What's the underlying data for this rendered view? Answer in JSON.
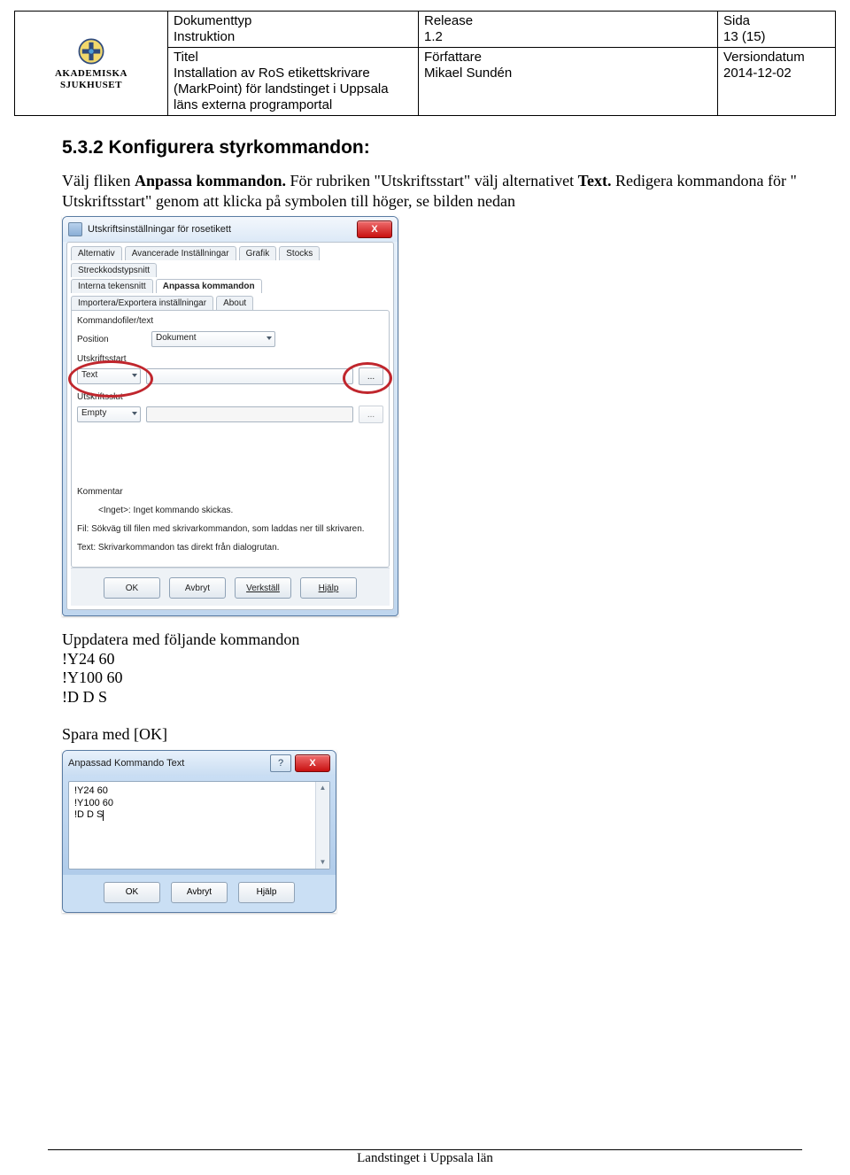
{
  "header": {
    "logo": {
      "line1": "AKADEMISKA",
      "line2": "SJUKHUSET"
    },
    "row1": {
      "doctype_label": "Dokumenttyp",
      "doctype_value": "Instruktion",
      "release_label": "Release",
      "release_value": "1.2",
      "page_label": "Sida",
      "page_value": "13 (15)"
    },
    "row2": {
      "title_label": "Titel",
      "title_value": "Installation av RoS etikettskrivare (MarkPoint) för landstinget i Uppsala läns externa programportal",
      "author_label": "Författare",
      "author_value": "Mikael Sundén",
      "versiondate_label": "Versiondatum",
      "versiondate_value": "2014-12-02"
    }
  },
  "section_heading": "5.3.2   Konfigurera styrkommandon:",
  "para": {
    "pre": "Välj fliken ",
    "bold1": "Anpassa kommandon.",
    "mid1": " För rubriken \"Utskriftsstart\" välj alternativet ",
    "bold2": "Text.",
    "mid2": " Redigera kommandona för \" Utskriftsstart\" genom att klicka på symbolen till höger, se bilden nedan"
  },
  "dlg1": {
    "title": "Utskriftsinställningar för rosetikett",
    "close": "X",
    "tabs_row1": [
      "Alternativ",
      "Avancerade Inställningar",
      "Grafik",
      "Stocks",
      "Streckkodstypsnitt"
    ],
    "tabs_row2": [
      "Interna tekensnitt",
      "Anpassa kommandon",
      "Importera/Exportera inställningar",
      "About"
    ],
    "active_tab": "Anpassa kommandon",
    "group_label": "Kommandofiler/text",
    "position_label": "Position",
    "position_value": "Dokument",
    "start_label": "Utskriftsstart",
    "start_value": "Text",
    "start_btn": "...",
    "end_label": "Utskriftsslut",
    "end_value": "Empty",
    "end_btn": "...",
    "comment_label": "Kommentar",
    "hint1": "<Inget>: Inget kommando skickas.",
    "hint2": "Fil: Sökväg till filen med skrivarkommandon, som laddas ner till skrivaren.",
    "hint3": "Text: Skrivarkommandon tas direkt från dialogrutan.",
    "buttons": {
      "ok": "OK",
      "cancel": "Avbryt",
      "apply": "Verkställ",
      "help": "Hjälp"
    }
  },
  "commands_intro": "Uppdatera med följande kommandon",
  "commands": [
    "!Y24 60",
    "!Y100 60",
    "!D D S"
  ],
  "save_line": "Spara med [OK]",
  "dlg2": {
    "title": "Anpassad Kommando Text",
    "help": "?",
    "close": "X",
    "lines": [
      "!Y24 60",
      "!Y100 60",
      "!D D S"
    ],
    "buttons": {
      "ok": "OK",
      "cancel": "Avbryt",
      "help": "Hjälp"
    }
  },
  "footer": "Landstinget i Uppsala län"
}
